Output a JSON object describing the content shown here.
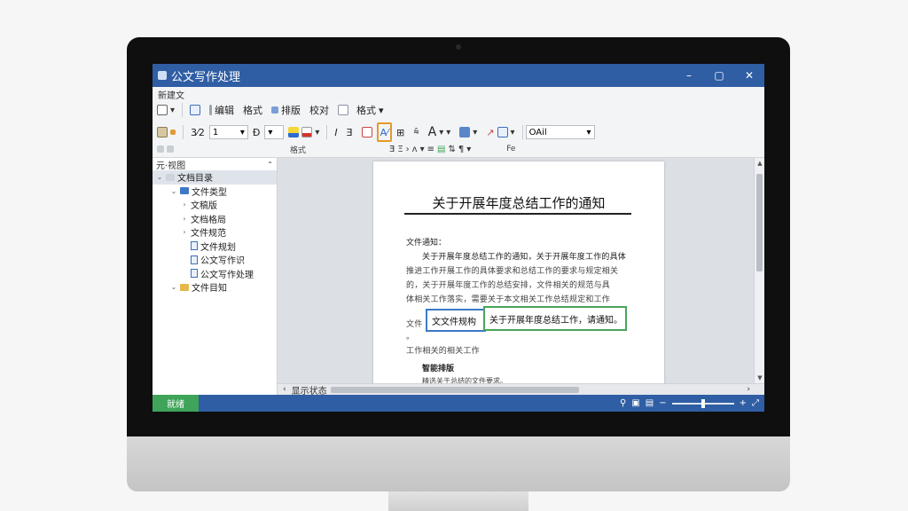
{
  "window": {
    "title": "公文写作处理",
    "controls": [
      "–",
      "▢",
      "✕"
    ]
  },
  "ribbon": {
    "menu_label": "新建文",
    "row1": {
      "edit": "编辑",
      "format": "格式",
      "layout": "排版",
      "review": "校对",
      "insert": "格式",
      "insert_caret": "▾"
    },
    "row2": {
      "list_indicator": "3⁄2",
      "font_size": "1",
      "bold": "B",
      "italic": "I",
      "strike": "Ǝ",
      "font_color_A": "A",
      "font_name": "OAil"
    },
    "row3": {
      "group_style": "格式",
      "group_para": "Fe"
    }
  },
  "nav": {
    "header": "元·视图",
    "items": [
      {
        "label": "文档目录",
        "level": 0,
        "icon": "folder-icon",
        "selected": true
      },
      {
        "label": "文件类型",
        "level": 1,
        "icon": "folder-icon",
        "selected": false
      },
      {
        "label": "文稿版",
        "level": 2,
        "icon": "arrow-icon",
        "selected": false
      },
      {
        "label": "文档格局",
        "level": 2,
        "icon": "arrow-icon",
        "selected": false
      },
      {
        "label": "文件规范",
        "level": 2,
        "icon": "arrow-icon",
        "selected": false
      },
      {
        "label": "文件规划",
        "level": 2,
        "icon": "doc-icon",
        "selected": false
      },
      {
        "label": "公文写作识",
        "level": 2,
        "icon": "doc-icon",
        "selected": false
      },
      {
        "label": "公文写作处理",
        "level": 2,
        "icon": "doc-icon",
        "selected": false
      },
      {
        "label": "文件目知",
        "level": 1,
        "icon": "folder-icon",
        "selected": false
      }
    ]
  },
  "document": {
    "title": "关于开展年度总结工作的通知",
    "salutation": "文件通知：",
    "paragraphs": [
      "关于开展年度总结工作的通知，关于开展年度工作的具体",
      "推进工作开展工作的具体要求和总结工作的要求与规定相关",
      "的，关于开展年度工作的总结安排，文件相关的规范与具",
      "体相关工作落实，需要关于本文相关工作总结规定和工作",
      "文件",
      "。",
      "工作相关的相关工作"
    ],
    "section_heading": "智能排版",
    "section_text": "精选关于总结的文件要求。",
    "callout_blue": "文文件规构",
    "callout_green": "关于开展年度总结工作，请通知。"
  },
  "bottom": {
    "hscroll_label": "显示状态"
  },
  "status": {
    "badge": "就绪",
    "zoom_pct": 50,
    "colors": {
      "titlebar": "#2f5ea4",
      "badge": "#3fa45a"
    }
  }
}
